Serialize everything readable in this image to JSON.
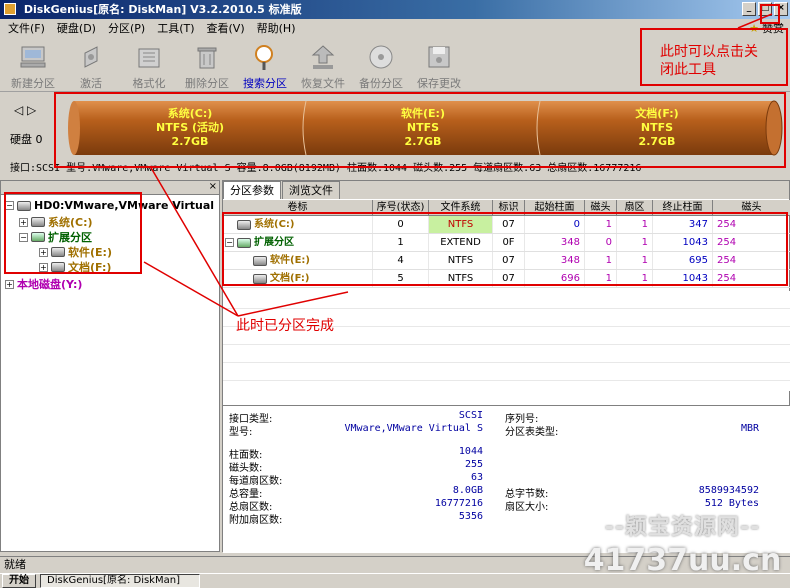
{
  "window": {
    "title": "DiskGenius[原名: DiskMan] V3.2.2010.5 标准版",
    "buttons": {
      "minimize": "_",
      "maximize": "□",
      "close": "×"
    }
  },
  "menu": {
    "items": [
      "文件(F)",
      "硬盘(D)",
      "分区(P)",
      "工具(T)",
      "查看(V)",
      "帮助(H)"
    ],
    "right_label": "赞赏"
  },
  "toolbar": {
    "tools": [
      {
        "label": "新建分区",
        "icon": "new-partition-icon"
      },
      {
        "label": "激活",
        "icon": "activate-icon"
      },
      {
        "label": "格式化",
        "icon": "format-icon"
      },
      {
        "label": "删除分区",
        "icon": "delete-partition-icon"
      },
      {
        "label": "搜索分区",
        "icon": "search-partition-icon"
      },
      {
        "label": "恢复文件",
        "icon": "recover-file-icon"
      },
      {
        "label": "备份分区",
        "icon": "backup-partition-icon"
      },
      {
        "label": "保存更改",
        "icon": "save-changes-icon"
      }
    ]
  },
  "disk_map": {
    "disk_label": "硬盘 0",
    "partitions": [
      {
        "name": "系统(C:)",
        "fs": "NTFS (活动)",
        "size": "2.7GB"
      },
      {
        "name": "软件(E:)",
        "fs": "NTFS",
        "size": "2.7GB"
      },
      {
        "name": "文档(F:)",
        "fs": "NTFS",
        "size": "2.7GB"
      }
    ],
    "info_line": "接口:SCSI  型号:VMware,VMware Virtual S  容量:8.0GB(8192MB)  柱面数:1044  磁头数:255  每道扇区数:63  总扇区数:16777216"
  },
  "tree": {
    "disk": "HD0:VMware,VMware Virtual",
    "c": "系统(C:)",
    "ext": "扩展分区",
    "e": "软件(E:)",
    "f": "文档(F:)",
    "local": "本地磁盘(Y:)"
  },
  "tabs": [
    "分区参数",
    "浏览文件"
  ],
  "table": {
    "headers": [
      "卷标",
      "序号(状态)",
      "文件系统",
      "标识",
      "起始柱面",
      "磁头",
      "扇区",
      "终止柱面",
      "磁头"
    ],
    "rows": [
      {
        "label": "系统(C:)",
        "idx": "0",
        "fs": "NTFS",
        "id": "07",
        "start": "0",
        "head": "1",
        "sector": "1",
        "end": "347",
        "head2": "254"
      },
      {
        "label": "扩展分区",
        "idx": "1",
        "fs": "EXTEND",
        "id": "0F",
        "start": "348",
        "head": "0",
        "sector": "1",
        "end": "1043",
        "head2": "254"
      },
      {
        "label": "软件(E:)",
        "idx": "4",
        "fs": "NTFS",
        "id": "07",
        "start": "348",
        "head": "1",
        "sector": "1",
        "end": "695",
        "head2": "254"
      },
      {
        "label": "文档(F:)",
        "idx": "5",
        "fs": "NTFS",
        "id": "07",
        "start": "696",
        "head": "1",
        "sector": "1",
        "end": "1043",
        "head2": "254"
      }
    ]
  },
  "details": {
    "iface_label": "接口类型:",
    "iface": "SCSI",
    "model_label": "型号:",
    "model": "VMware,VMware Virtual S",
    "serial_label": "序列号:",
    "serial": "",
    "ptype_label": "分区表类型:",
    "ptype": "MBR",
    "cyl_label": "柱面数:",
    "cyl": "1044",
    "heads_label": "磁头数:",
    "heads": "255",
    "spt_label": "每道扇区数:",
    "spt": "63",
    "cap_label": "总容量:",
    "cap": "8.0GB",
    "bytes_label": "总字节数:",
    "bytes": "8589934592",
    "sectors_label": "总扇区数:",
    "sectors": "16777216",
    "ssize_label": "扇区大小:",
    "ssize": "512 Bytes",
    "extra_label": "附加扇区数:",
    "extra": "5356"
  },
  "status": "就绪",
  "taskbar": {
    "start": "开始",
    "task": "DiskGenius[原名: DiskMan]"
  },
  "annotations": {
    "close_hint": "此时可以点击关\n闭此工具",
    "close_hint_1": "此时可以点击关",
    "close_hint_2": "闭此工具",
    "done": "此时已分区完成"
  },
  "watermark": {
    "line1": "--颖宝资源网--",
    "line2": "41737uu.cn"
  },
  "colors": {
    "partition_fill": "#b8601c",
    "partition_text": "#ffff40",
    "annotation": "#e00000"
  }
}
